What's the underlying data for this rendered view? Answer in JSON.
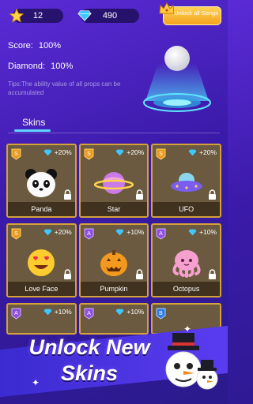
{
  "header": {
    "stars_count": "12",
    "diamonds_count": "490",
    "unlock_button_label": "Unlock all Songs"
  },
  "stats": {
    "score_label": "Score:",
    "score_value": "100%",
    "diamond_label": "Diamond:",
    "diamond_value": "100%",
    "tip": "Tips:The ability value of all props can be accumulated"
  },
  "tab": {
    "label": "Skins"
  },
  "skins": [
    {
      "name": "Panda",
      "bonus": "+20%",
      "rank": "S",
      "locked": true
    },
    {
      "name": "Star",
      "bonus": "+20%",
      "rank": "S",
      "locked": true
    },
    {
      "name": "UFO",
      "bonus": "+20%",
      "rank": "S",
      "locked": true
    },
    {
      "name": "Love Face",
      "bonus": "+20%",
      "rank": "S",
      "locked": true
    },
    {
      "name": "Pumpkin",
      "bonus": "+10%",
      "rank": "A",
      "locked": true
    },
    {
      "name": "Octopus",
      "bonus": "+10%",
      "rank": "A",
      "locked": true
    },
    {
      "name": "",
      "bonus": "+10%",
      "rank": "A",
      "locked": false
    },
    {
      "name": "",
      "bonus": "+10%",
      "rank": "A",
      "locked": false
    },
    {
      "name": "",
      "bonus": "",
      "rank": "B",
      "locked": false
    }
  ],
  "promo": {
    "title": "Unlock New Skins"
  },
  "colors": {
    "gold": "#d4a23b",
    "cyan": "#5fd5ff",
    "purple": "#3a1aa8"
  }
}
